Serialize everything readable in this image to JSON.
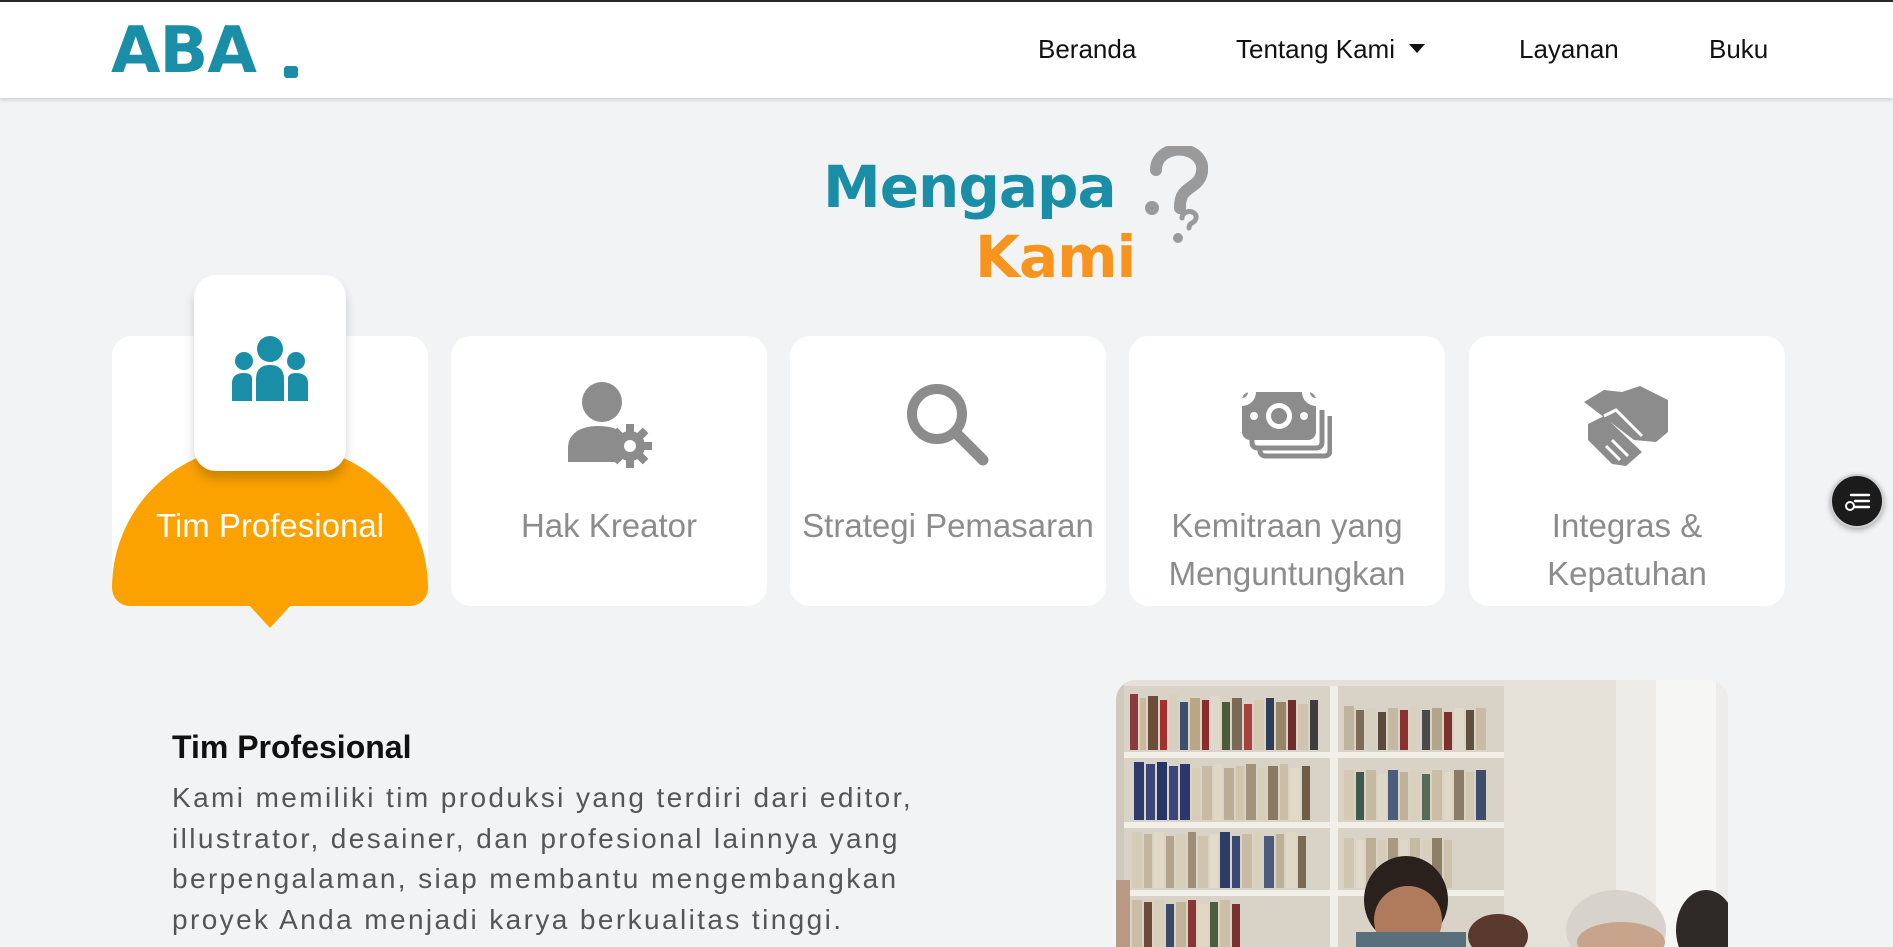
{
  "nav": {
    "logo": "ABA",
    "items": [
      {
        "label": "Beranda"
      },
      {
        "label": "Tentang Kami",
        "has_dropdown": true
      },
      {
        "label": "Layanan"
      },
      {
        "label": "Buku"
      }
    ]
  },
  "section": {
    "title_line1": "Mengapa",
    "title_line2": "Kami",
    "features": [
      {
        "label": "Tim Profesional",
        "icon": "team-icon",
        "active": true
      },
      {
        "label": "Hak Kreator",
        "icon": "user-gear-icon"
      },
      {
        "label": "Strategi Pemasaran",
        "icon": "search-icon"
      },
      {
        "label": "Kemitraan yang Menguntungkan",
        "icon": "money-icon"
      },
      {
        "label": "Integras & Kepatuhan",
        "icon": "handshake-icon"
      }
    ]
  },
  "detail": {
    "title": "Tim Profesional",
    "text": "Kami memiliki tim produksi yang terdiri dari editor, illustrator, desainer, dan profesional lainnya yang berpengalaman, siap membantu mengembangkan proyek Anda menjadi karya berkualitas tinggi."
  },
  "colors": {
    "brand_teal": "#1a8ea6",
    "brand_orange": "#f7941d",
    "active_yellow": "#fba200",
    "icon_gray": "#8c8c8c"
  },
  "floating": {
    "icon": "toc-list-icon"
  }
}
